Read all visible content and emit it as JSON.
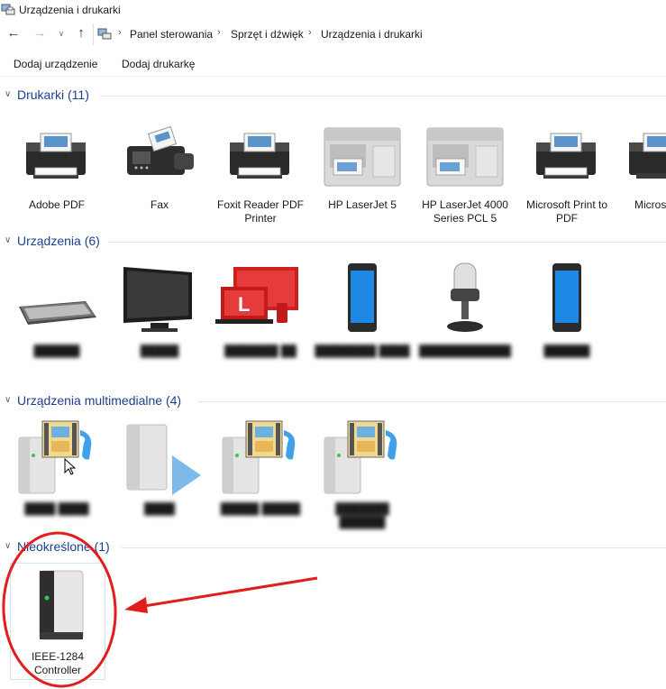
{
  "window": {
    "title": "Urządzenia i drukarki"
  },
  "breadcrumb": [
    "Panel sterowania",
    "Sprzęt i dźwięk",
    "Urządzenia i drukarki"
  ],
  "toolbar": {
    "add_device": "Dodaj urządzenie",
    "add_printer": "Dodaj drukarkę"
  },
  "groups": {
    "printers": {
      "title": "Drukarki (11)",
      "items": [
        {
          "label": "Adobe PDF",
          "icon": "printer-icon"
        },
        {
          "label": "Fax",
          "icon": "fax-icon"
        },
        {
          "label": "Foxit Reader PDF Printer",
          "icon": "printer-icon"
        },
        {
          "label": "HP LaserJet 5",
          "icon": "laser-printer-icon"
        },
        {
          "label": "HP LaserJet 4000 Series PCL 5",
          "icon": "laser-printer-icon"
        },
        {
          "label": "Microsoft Print to PDF",
          "icon": "printer-icon"
        },
        {
          "label": "Micros Docume",
          "icon": "printer-icon"
        }
      ]
    },
    "devices": {
      "title": "Urządzenia (6)",
      "items": [
        {
          "icon": "keyboard-icon"
        },
        {
          "icon": "monitor-icon"
        },
        {
          "icon": "computer-icon"
        },
        {
          "icon": "phone-icon"
        },
        {
          "icon": "microphone-icon"
        },
        {
          "icon": "phone-icon"
        }
      ]
    },
    "multimedia": {
      "title": "Urządzenia multimedialne (4)",
      "items": [
        {
          "icon": "media-server-icon"
        },
        {
          "icon": "media-player-icon"
        },
        {
          "icon": "media-server-icon"
        },
        {
          "icon": "media-server-icon"
        }
      ]
    },
    "unspecified": {
      "title": "Nieokreślone (1)",
      "items": [
        {
          "label": "IEEE-1284 Controller",
          "icon": "generic-device-icon"
        }
      ]
    }
  },
  "annotation": {
    "color": "#e11d1d"
  }
}
